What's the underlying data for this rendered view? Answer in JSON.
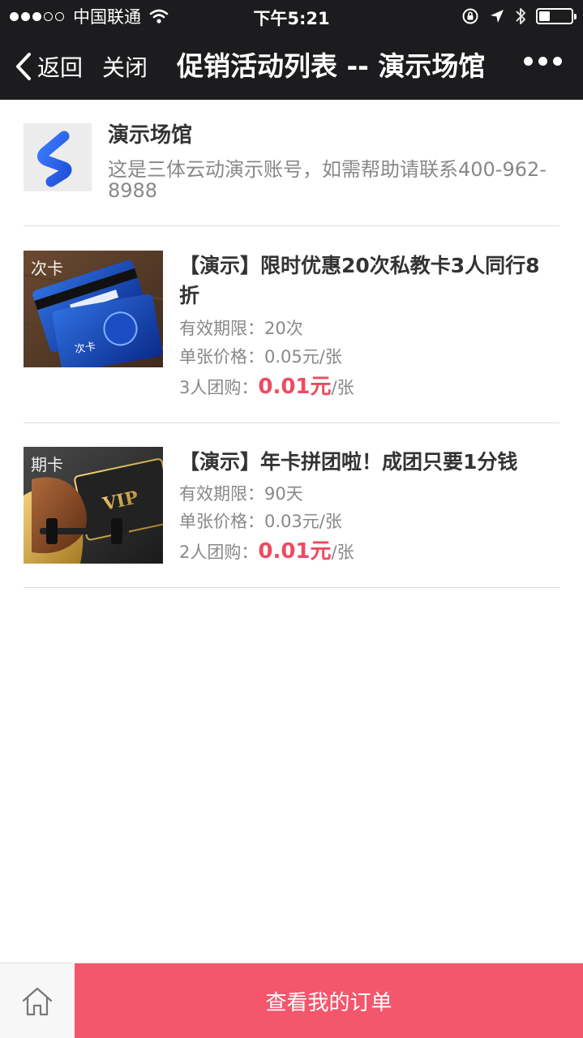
{
  "status_bar": {
    "carrier": "中国联通",
    "time": "下午5:21",
    "signal_bars_filled": 3,
    "signal_bars_total": 5,
    "battery_level": 0.35
  },
  "nav": {
    "back_label": "返回",
    "close_label": "关闭",
    "title": "促销活动列表 -- 演示场馆"
  },
  "venue": {
    "name": "演示场馆",
    "description": "这是三体云动演示账号，如需帮助请联系400-962-8988",
    "logo_color": "#2a62f5"
  },
  "products": [
    {
      "tag": "次卡",
      "title": "【演示】限时优惠20次私教卡3人同行8折",
      "validity_label": "有效期限：",
      "validity_value": "20次",
      "unit_price_label": "单张价格：",
      "unit_price_value": "0.05元/张",
      "group_label": "3人团购：",
      "group_price": "0.01元",
      "group_unit": "/张"
    },
    {
      "tag": "期卡",
      "title": "【演示】年卡拼团啦！成团只要1分钱",
      "validity_label": "有效期限：",
      "validity_value": "90天",
      "unit_price_label": "单张价格：",
      "unit_price_value": "0.03元/张",
      "group_label": "2人团购：",
      "group_price": "0.01元",
      "group_unit": "/张"
    }
  ],
  "bottom": {
    "home_icon": "home-icon",
    "order_button": "查看我的订单"
  },
  "colors": {
    "accent": "#f4566c",
    "price": "#f04a5f",
    "header_bg": "#1c1c1e"
  }
}
